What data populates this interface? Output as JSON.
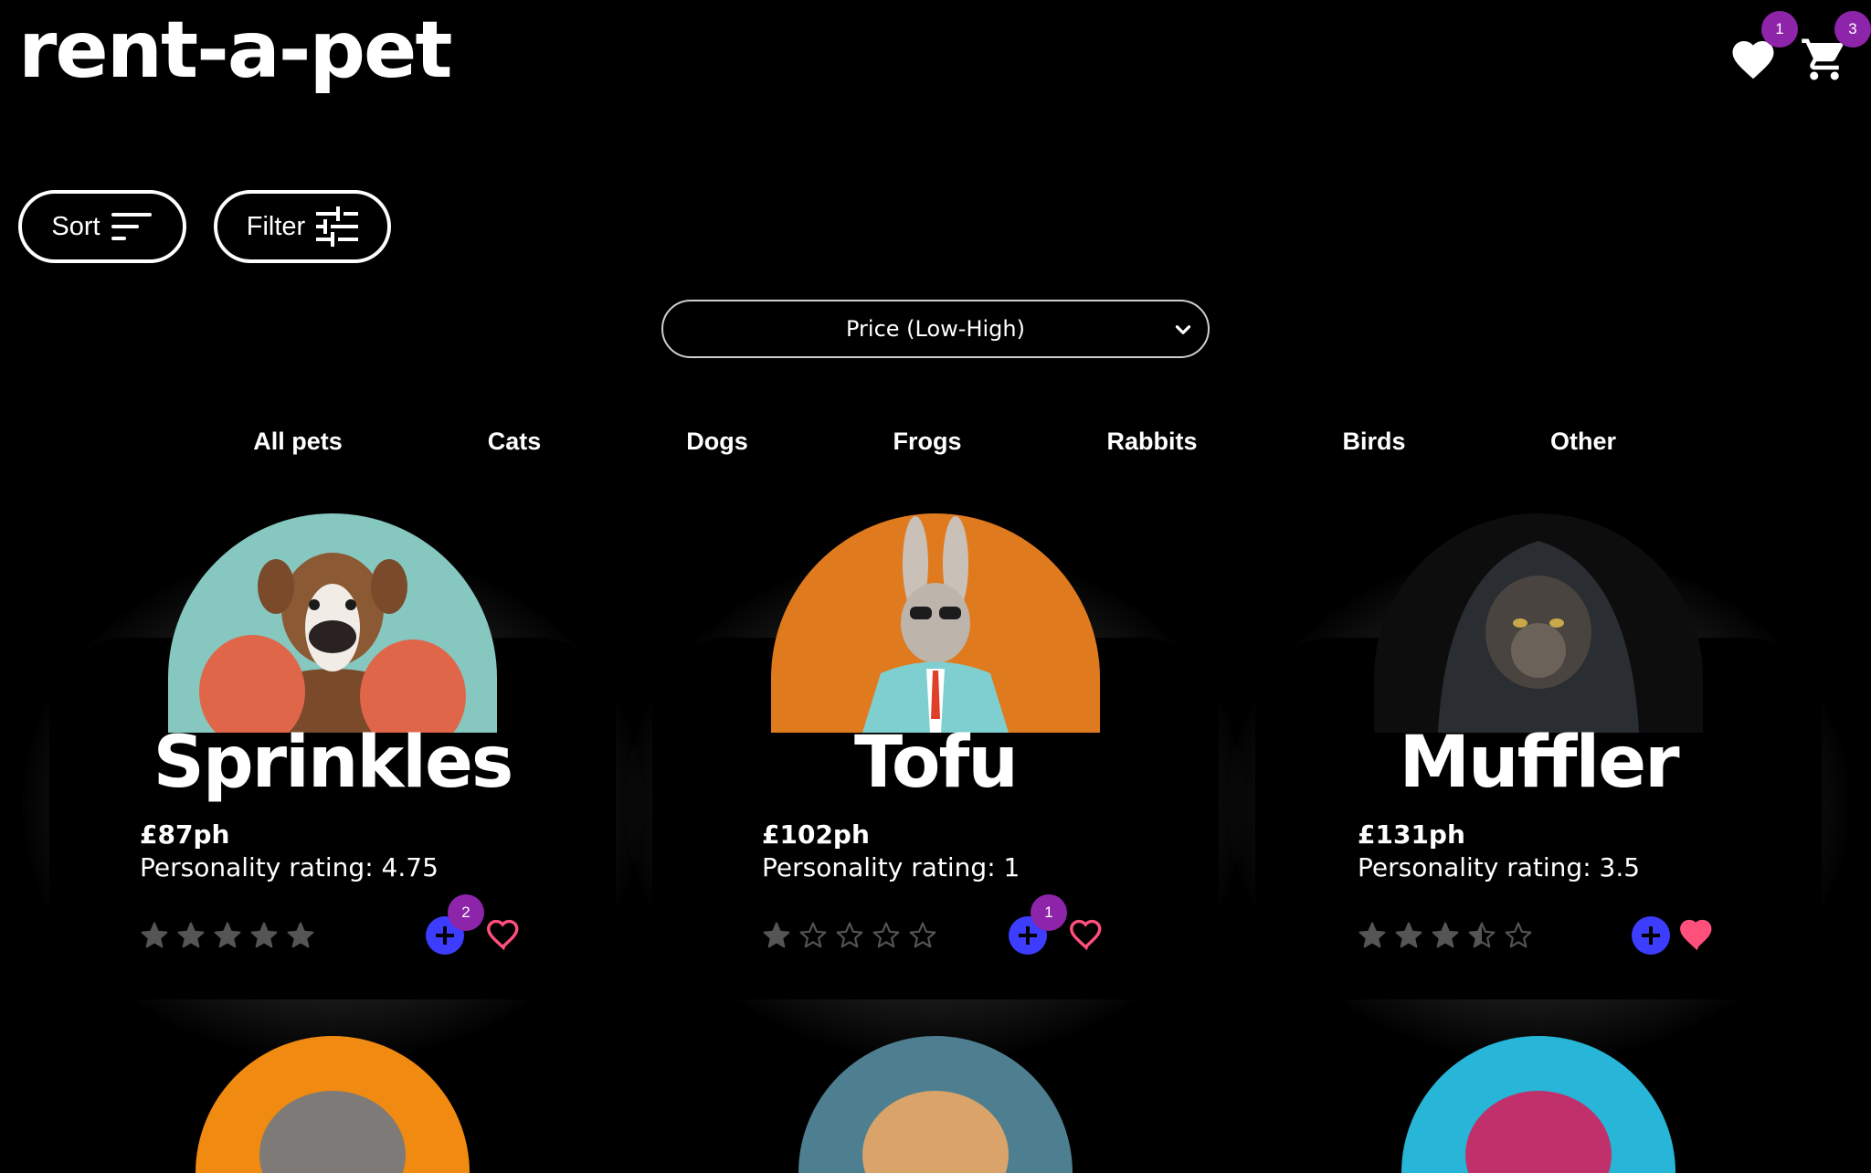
{
  "app": {
    "logo_text": "rent-a-pet"
  },
  "header": {
    "favourites_count": "1",
    "cart_count": "3"
  },
  "toolbar": {
    "sort_label": "Sort",
    "filter_label": "Filter",
    "sort_select_value": "Price (Low-High)"
  },
  "categories": [
    "All pets",
    "Cats",
    "Dogs",
    "Frogs",
    "Rabbits",
    "Birds",
    "Other"
  ],
  "pets": [
    {
      "name": "Sprinkles",
      "price": "£87ph",
      "rating_text": "Personality rating: 4.75",
      "rating": 4.75,
      "cart_count": "2",
      "favourited": false,
      "bg_color": "#86c8c0",
      "icon": "boxer-dog-image"
    },
    {
      "name": "Tofu",
      "price": "£102ph",
      "rating_text": "Personality rating: 1",
      "rating": 1,
      "cart_count": "1",
      "favourited": false,
      "bg_color": "#e07a1e",
      "icon": "rabbit-image"
    },
    {
      "name": "Muffler",
      "price": "£131ph",
      "rating_text": "Personality rating: 3.5",
      "rating": 3.5,
      "cart_count": "",
      "favourited": true,
      "bg_color": "#0d0d0d",
      "icon": "hooded-cat-image"
    }
  ],
  "colors": {
    "accent_badge": "#8e24aa",
    "add_button": "#3d3dff",
    "heart": "#ff4f7b",
    "star": "#555555"
  }
}
